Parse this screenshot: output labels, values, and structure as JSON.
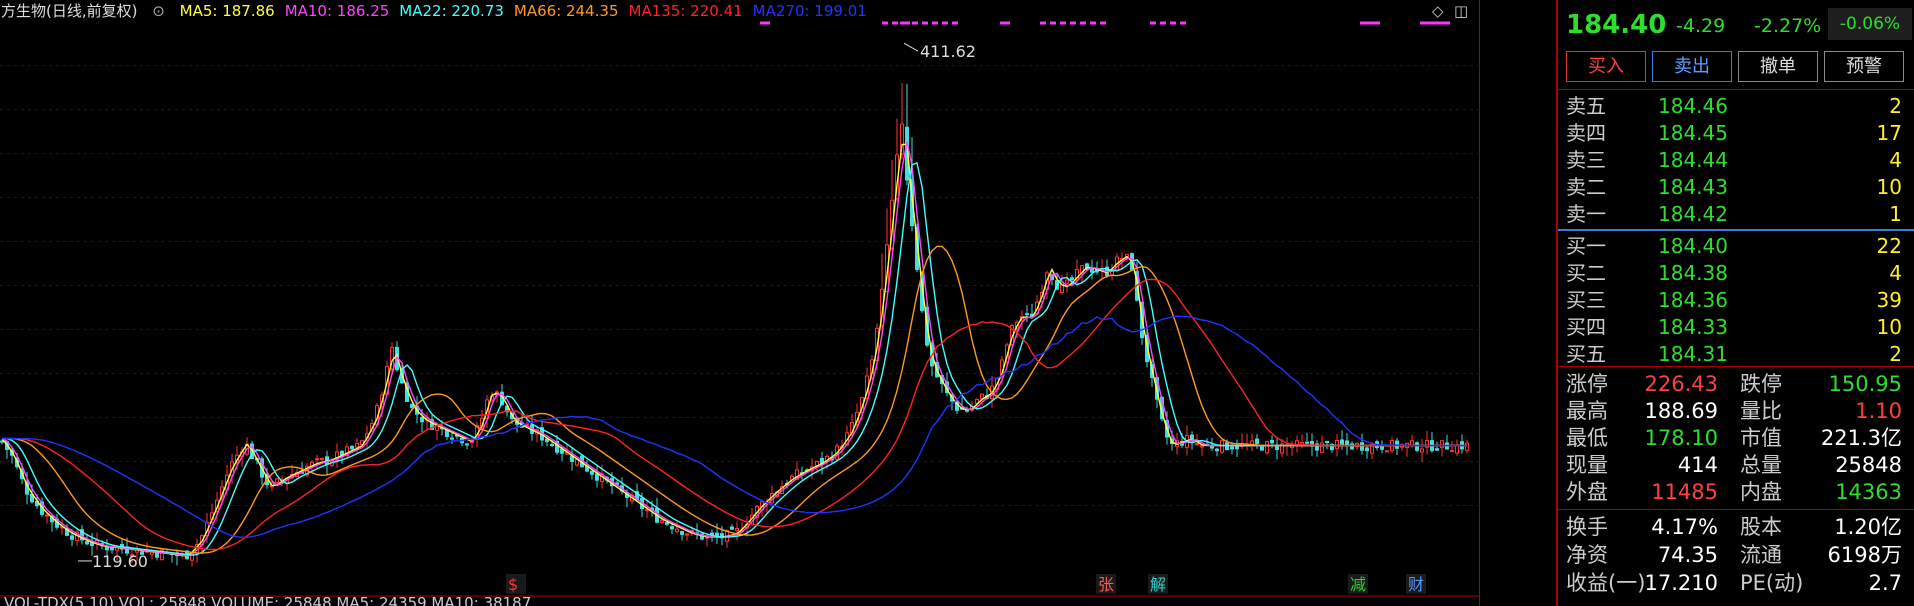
{
  "legend": {
    "title": "东方生物(日线,前复权)",
    "items": [
      {
        "label": "MA5: 187.86",
        "color": "#ffff44"
      },
      {
        "label": "MA10: 186.25",
        "color": "#ff44ff"
      },
      {
        "label": "MA22: 220.73",
        "color": "#44ffff"
      },
      {
        "label": "MA66: 244.35",
        "color": "#ff9922"
      },
      {
        "label": "MA135: 220.41",
        "color": "#ff2222"
      },
      {
        "label": "MA270: 199.01",
        "color": "#2233ff"
      }
    ]
  },
  "chart_tools": {
    "diamond_icon": "◇",
    "window_icon": "◫"
  },
  "bottom_indicator": {
    "text": "VOL-TDX(5,10)  VOL: 25848  VOLUME: 25848  MA5: 24359  MA10: 38187"
  },
  "chart_data": {
    "type": "candlestick",
    "yticks": [
      "400.0",
      "375.0",
      "350.0",
      "325.0",
      "300.0",
      "275.0",
      "250.0",
      "225.0",
      "200.0",
      "175.0",
      "150.0"
    ],
    "ylim": [
      119,
      410
    ],
    "cursor_price": "119.44",
    "high_label": "411.62",
    "low_label": "119.60",
    "event_markers": [
      {
        "text": "$",
        "color": "#ff3333"
      },
      {
        "text": "张",
        "color": "#ff5555"
      },
      {
        "text": "解",
        "color": "#33cccc"
      },
      {
        "text": "减",
        "color": "#33cc33"
      },
      {
        "text": "财",
        "color": "#5599ff"
      }
    ],
    "price_path": [
      [
        0,
        188
      ],
      [
        12,
        178
      ],
      [
        25,
        160
      ],
      [
        40,
        148
      ],
      [
        55,
        140
      ],
      [
        70,
        134
      ],
      [
        85,
        130
      ],
      [
        100,
        127
      ],
      [
        115,
        126
      ],
      [
        130,
        125
      ],
      [
        145,
        124
      ],
      [
        160,
        123
      ],
      [
        175,
        122
      ],
      [
        185,
        121
      ],
      [
        200,
        130
      ],
      [
        215,
        150
      ],
      [
        230,
        172
      ],
      [
        245,
        186
      ],
      [
        258,
        172
      ],
      [
        270,
        160
      ],
      [
        285,
        166
      ],
      [
        300,
        170
      ],
      [
        315,
        174
      ],
      [
        330,
        176
      ],
      [
        345,
        180
      ],
      [
        360,
        184
      ],
      [
        375,
        200
      ],
      [
        385,
        222
      ],
      [
        392,
        240
      ],
      [
        400,
        222
      ],
      [
        412,
        205
      ],
      [
        425,
        198
      ],
      [
        440,
        194
      ],
      [
        455,
        190
      ],
      [
        470,
        186
      ],
      [
        480,
        196
      ],
      [
        490,
        215
      ],
      [
        500,
        212
      ],
      [
        512,
        198
      ],
      [
        525,
        194
      ],
      [
        540,
        190
      ],
      [
        555,
        184
      ],
      [
        570,
        178
      ],
      [
        585,
        172
      ],
      [
        600,
        166
      ],
      [
        615,
        160
      ],
      [
        630,
        154
      ],
      [
        645,
        148
      ],
      [
        660,
        142
      ],
      [
        675,
        138
      ],
      [
        690,
        134
      ],
      [
        705,
        132
      ],
      [
        720,
        132
      ],
      [
        735,
        134
      ],
      [
        745,
        140
      ],
      [
        760,
        150
      ],
      [
        775,
        158
      ],
      [
        790,
        165
      ],
      [
        805,
        170
      ],
      [
        820,
        174
      ],
      [
        835,
        180
      ],
      [
        850,
        192
      ],
      [
        862,
        210
      ],
      [
        872,
        232
      ],
      [
        880,
        262
      ],
      [
        888,
        300
      ],
      [
        895,
        338
      ],
      [
        902,
        368
      ],
      [
        908,
        330
      ],
      [
        915,
        296
      ],
      [
        922,
        260
      ],
      [
        930,
        232
      ],
      [
        938,
        222
      ],
      [
        948,
        212
      ],
      [
        958,
        205
      ],
      [
        968,
        204
      ],
      [
        978,
        210
      ],
      [
        990,
        214
      ],
      [
        1000,
        226
      ],
      [
        1010,
        248
      ],
      [
        1020,
        258
      ],
      [
        1030,
        256
      ],
      [
        1040,
        270
      ],
      [
        1048,
        286
      ],
      [
        1056,
        276
      ],
      [
        1065,
        274
      ],
      [
        1075,
        280
      ],
      [
        1085,
        286
      ],
      [
        1095,
        284
      ],
      [
        1105,
        282
      ],
      [
        1115,
        288
      ],
      [
        1125,
        292
      ],
      [
        1132,
        286
      ],
      [
        1140,
        252
      ],
      [
        1150,
        225
      ],
      [
        1160,
        200
      ],
      [
        1170,
        184
      ],
      [
        1180,
        186
      ],
      [
        1190,
        188
      ],
      [
        1200,
        184
      ]
    ],
    "ma": [
      {
        "name": "MA5",
        "color": "#ffff44",
        "lag": 3,
        "smooth": 2
      },
      {
        "name": "MA10",
        "color": "#ff44ff",
        "lag": 6,
        "smooth": 4
      },
      {
        "name": "MA22",
        "color": "#44ffff",
        "lag": 14,
        "smooth": 8
      },
      {
        "name": "MA66",
        "color": "#ff9922",
        "lag": 38,
        "smooth": 26
      },
      {
        "name": "MA135",
        "color": "#ff2222",
        "lag": 70,
        "smooth": 55
      },
      {
        "name": "MA270",
        "color": "#2233ff",
        "lag": 120,
        "smooth": 90
      }
    ]
  },
  "quote": {
    "price": "184.40",
    "change": "-4.29",
    "pct": "-2.27%",
    "speed": "-0.06%"
  },
  "trade_buttons": {
    "buy": "买入",
    "sell": "卖出",
    "cancel": "撤单",
    "alert": "预警"
  },
  "orderbook": {
    "asks": [
      {
        "label": "卖五",
        "price": "184.46",
        "vol": "2"
      },
      {
        "label": "卖四",
        "price": "184.45",
        "vol": "17"
      },
      {
        "label": "卖三",
        "price": "184.44",
        "vol": "4"
      },
      {
        "label": "卖二",
        "price": "184.43",
        "vol": "10"
      },
      {
        "label": "卖一",
        "price": "184.42",
        "vol": "1"
      }
    ],
    "bids": [
      {
        "label": "买一",
        "price": "184.40",
        "vol": "22"
      },
      {
        "label": "买二",
        "price": "184.38",
        "vol": "4"
      },
      {
        "label": "买三",
        "price": "184.36",
        "vol": "39"
      },
      {
        "label": "买四",
        "price": "184.33",
        "vol": "10"
      },
      {
        "label": "买五",
        "price": "184.31",
        "vol": "2"
      }
    ]
  },
  "stats1": [
    {
      "l1": "涨停",
      "v1": "226.43",
      "c1": "red",
      "l2": "跌停",
      "v2": "150.95",
      "c2": "green"
    },
    {
      "l1": "最高",
      "v1": "188.69",
      "c1": "white",
      "l2": "量比",
      "v2": "1.10",
      "c2": "red"
    },
    {
      "l1": "最低",
      "v1": "178.10",
      "c1": "green",
      "l2": "市值",
      "v2": "221.3亿",
      "c2": "white"
    },
    {
      "l1": "现量",
      "v1": "414",
      "c1": "white",
      "l2": "总量",
      "v2": "25848",
      "c2": "white"
    },
    {
      "l1": "外盘",
      "v1": "11485",
      "c1": "red",
      "l2": "内盘",
      "v2": "14363",
      "c2": "green"
    }
  ],
  "stats2": [
    {
      "l1": "换手",
      "v1": "4.17%",
      "c1": "white",
      "l2": "股本",
      "v2": "1.20亿",
      "c2": "white"
    },
    {
      "l1": "净资",
      "v1": "74.35",
      "c1": "white",
      "l2": "流通",
      "v2": "6198万",
      "c2": "white"
    },
    {
      "l1": "收益(一)",
      "v1": "17.210",
      "c1": "white",
      "l2": "PE(动)",
      "v2": "2.7",
      "c2": "white"
    }
  ]
}
